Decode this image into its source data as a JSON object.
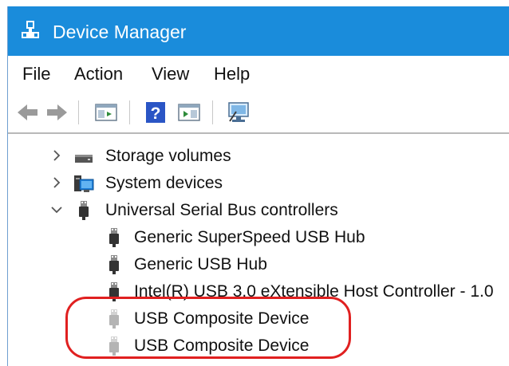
{
  "window": {
    "title": "Device Manager",
    "icon": "device-manager-icon"
  },
  "menu": {
    "items": [
      "File",
      "Action",
      "View",
      "Help"
    ]
  },
  "toolbar": {
    "buttons": [
      "back-arrow-icon",
      "forward-arrow-icon",
      "show-hide-console-tree-icon",
      "help-icon",
      "properties-icon",
      "scan-hardware-changes-icon"
    ]
  },
  "tree": {
    "categories": [
      {
        "label": "Storage volumes",
        "expanded": false,
        "icon": "storage-volume-icon"
      },
      {
        "label": "System devices",
        "expanded": false,
        "icon": "system-devices-icon"
      },
      {
        "label": "Universal Serial Bus controllers",
        "expanded": true,
        "icon": "usb-plug-icon"
      }
    ],
    "usb_children": [
      {
        "label": "Generic SuperSpeed USB Hub",
        "icon": "usb-plug-icon",
        "state": "normal"
      },
      {
        "label": "Generic USB Hub",
        "icon": "usb-plug-icon",
        "state": "normal"
      },
      {
        "label": "Intel(R) USB 3.0 eXtensible Host Controller - 1.0",
        "icon": "usb-plug-icon",
        "state": "normal"
      },
      {
        "label": "USB Composite Device",
        "icon": "usb-plug-icon",
        "state": "disconnected"
      },
      {
        "label": "USB Composite Device",
        "icon": "usb-plug-icon",
        "state": "disconnected"
      }
    ]
  },
  "annotation": {
    "color": "#e02020"
  },
  "colors": {
    "titlebar": "#1a8cdb",
    "title_text": "#ffffff"
  }
}
